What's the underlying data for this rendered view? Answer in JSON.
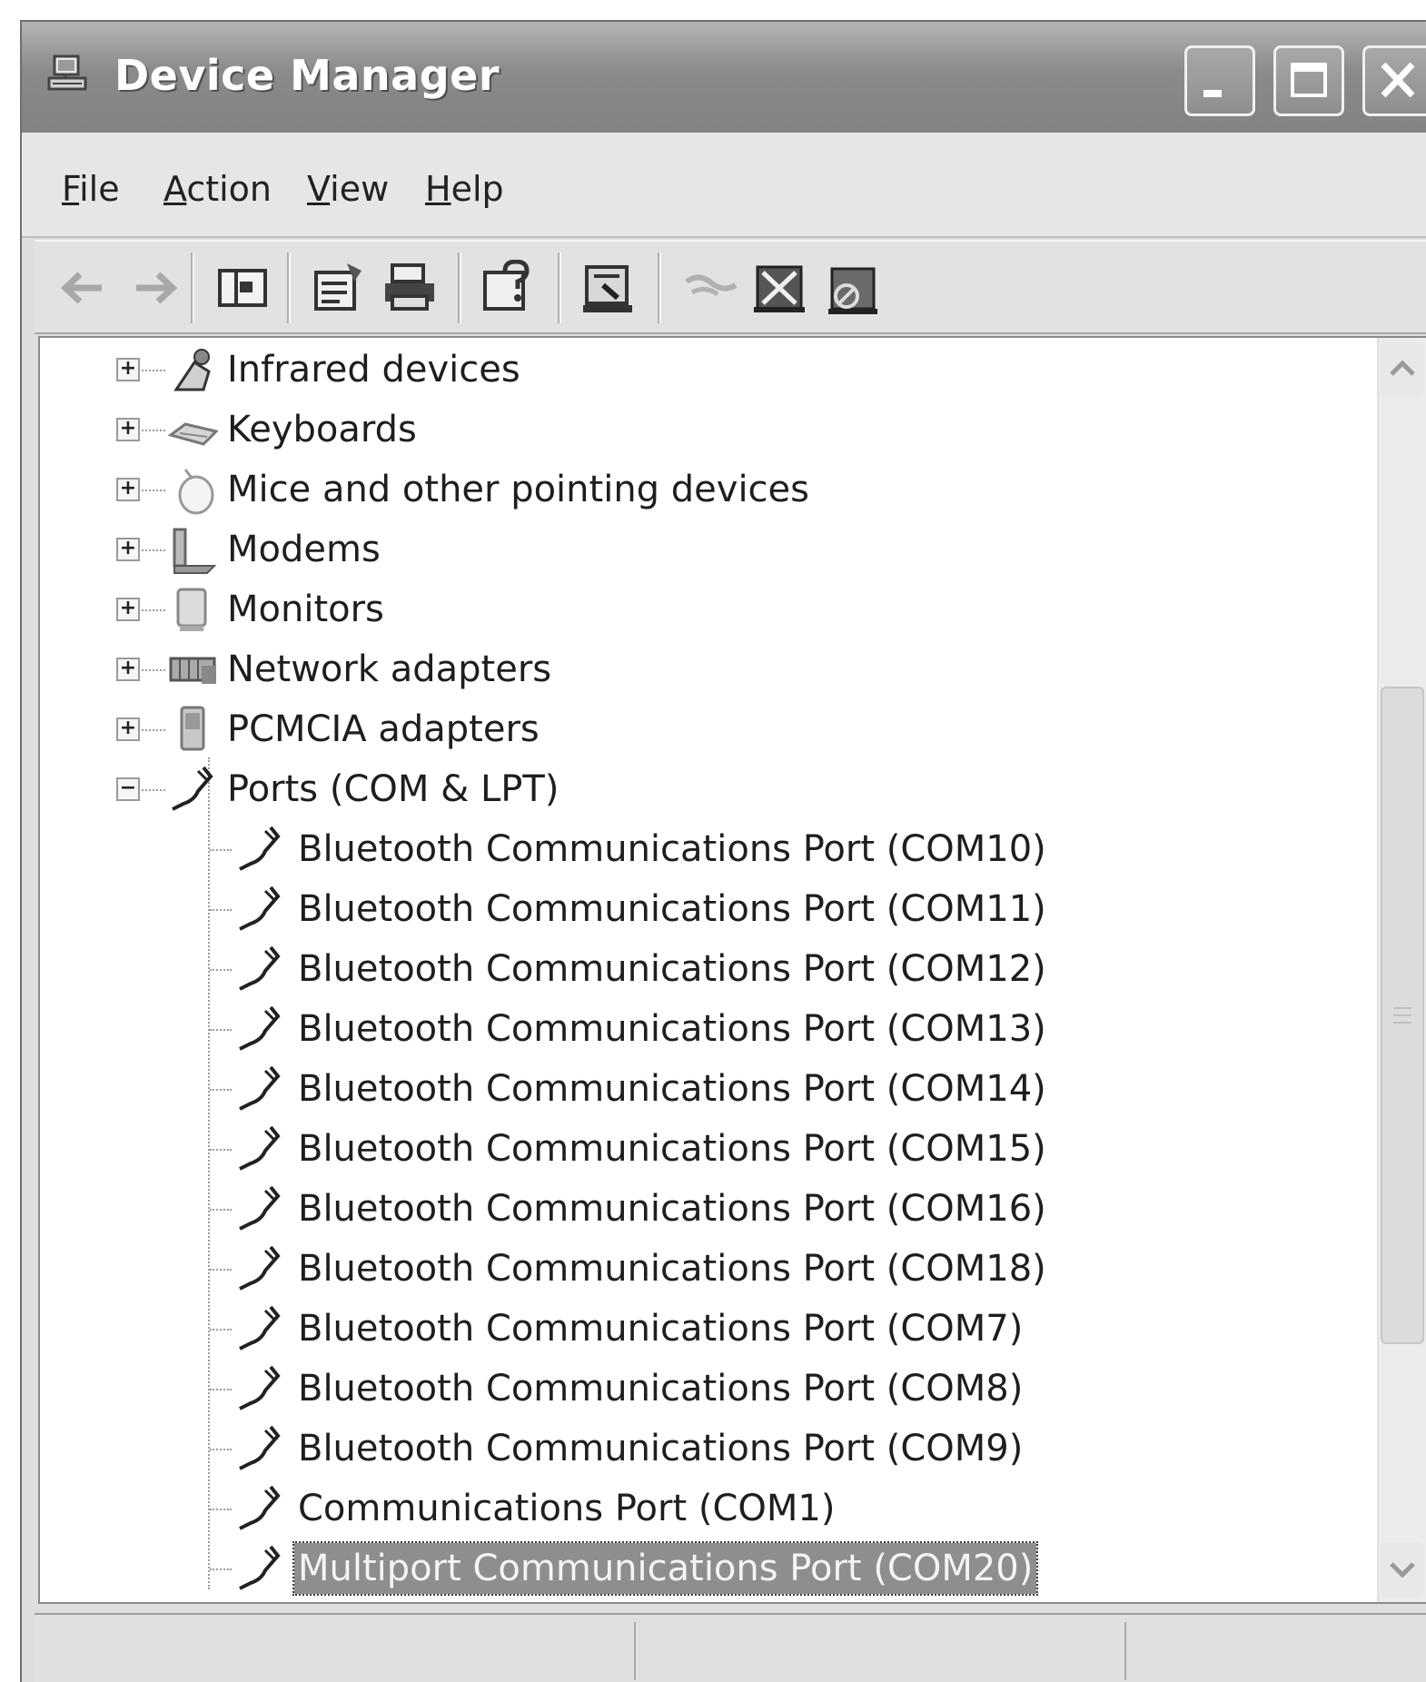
{
  "window": {
    "title": "Device Manager"
  },
  "menu": [
    {
      "pre": "",
      "u": "F",
      "post": "ile"
    },
    {
      "pre": "",
      "u": "A",
      "post": "ction"
    },
    {
      "pre": "",
      "u": "V",
      "post": "iew"
    },
    {
      "pre": "",
      "u": "H",
      "post": "elp"
    }
  ],
  "toolbar": [
    "back-icon",
    "forward-icon",
    "show-hide-console-tree-icon",
    "properties-icon",
    "print-icon",
    "help-icon",
    "update-driver-icon",
    "scan-hardware-icon",
    "uninstall-icon",
    "disable-icon"
  ],
  "tree": {
    "categories": [
      {
        "label": "Infrared devices",
        "icon": "infrared-icon",
        "expanded": false
      },
      {
        "label": "Keyboards",
        "icon": "keyboard-icon",
        "expanded": false
      },
      {
        "label": "Mice and other pointing devices",
        "icon": "mouse-icon",
        "expanded": false
      },
      {
        "label": "Modems",
        "icon": "modem-icon",
        "expanded": false
      },
      {
        "label": "Monitors",
        "icon": "monitor-icon",
        "expanded": false
      },
      {
        "label": "Network adapters",
        "icon": "network-adapter-icon",
        "expanded": false
      },
      {
        "label": "PCMCIA adapters",
        "icon": "pcmcia-icon",
        "expanded": false
      },
      {
        "label": "Ports (COM & LPT)",
        "icon": "port-icon",
        "expanded": true
      }
    ],
    "ports": [
      "Bluetooth Communications Port (COM10)",
      "Bluetooth Communications Port (COM11)",
      "Bluetooth Communications Port (COM12)",
      "Bluetooth Communications Port (COM13)",
      "Bluetooth Communications Port (COM14)",
      "Bluetooth Communications Port (COM15)",
      "Bluetooth Communications Port (COM16)",
      "Bluetooth Communications Port (COM18)",
      "Bluetooth Communications Port (COM7)",
      "Bluetooth Communications Port (COM8)",
      "Bluetooth Communications Port (COM9)",
      "Communications Port (COM1)",
      "Multiport Communications Port (COM20)"
    ],
    "selected_port": "Multiport Communications Port (COM20)"
  },
  "colors": {
    "selection_bg": "#8e8e8e",
    "title_bar": "#8a8a8a"
  }
}
